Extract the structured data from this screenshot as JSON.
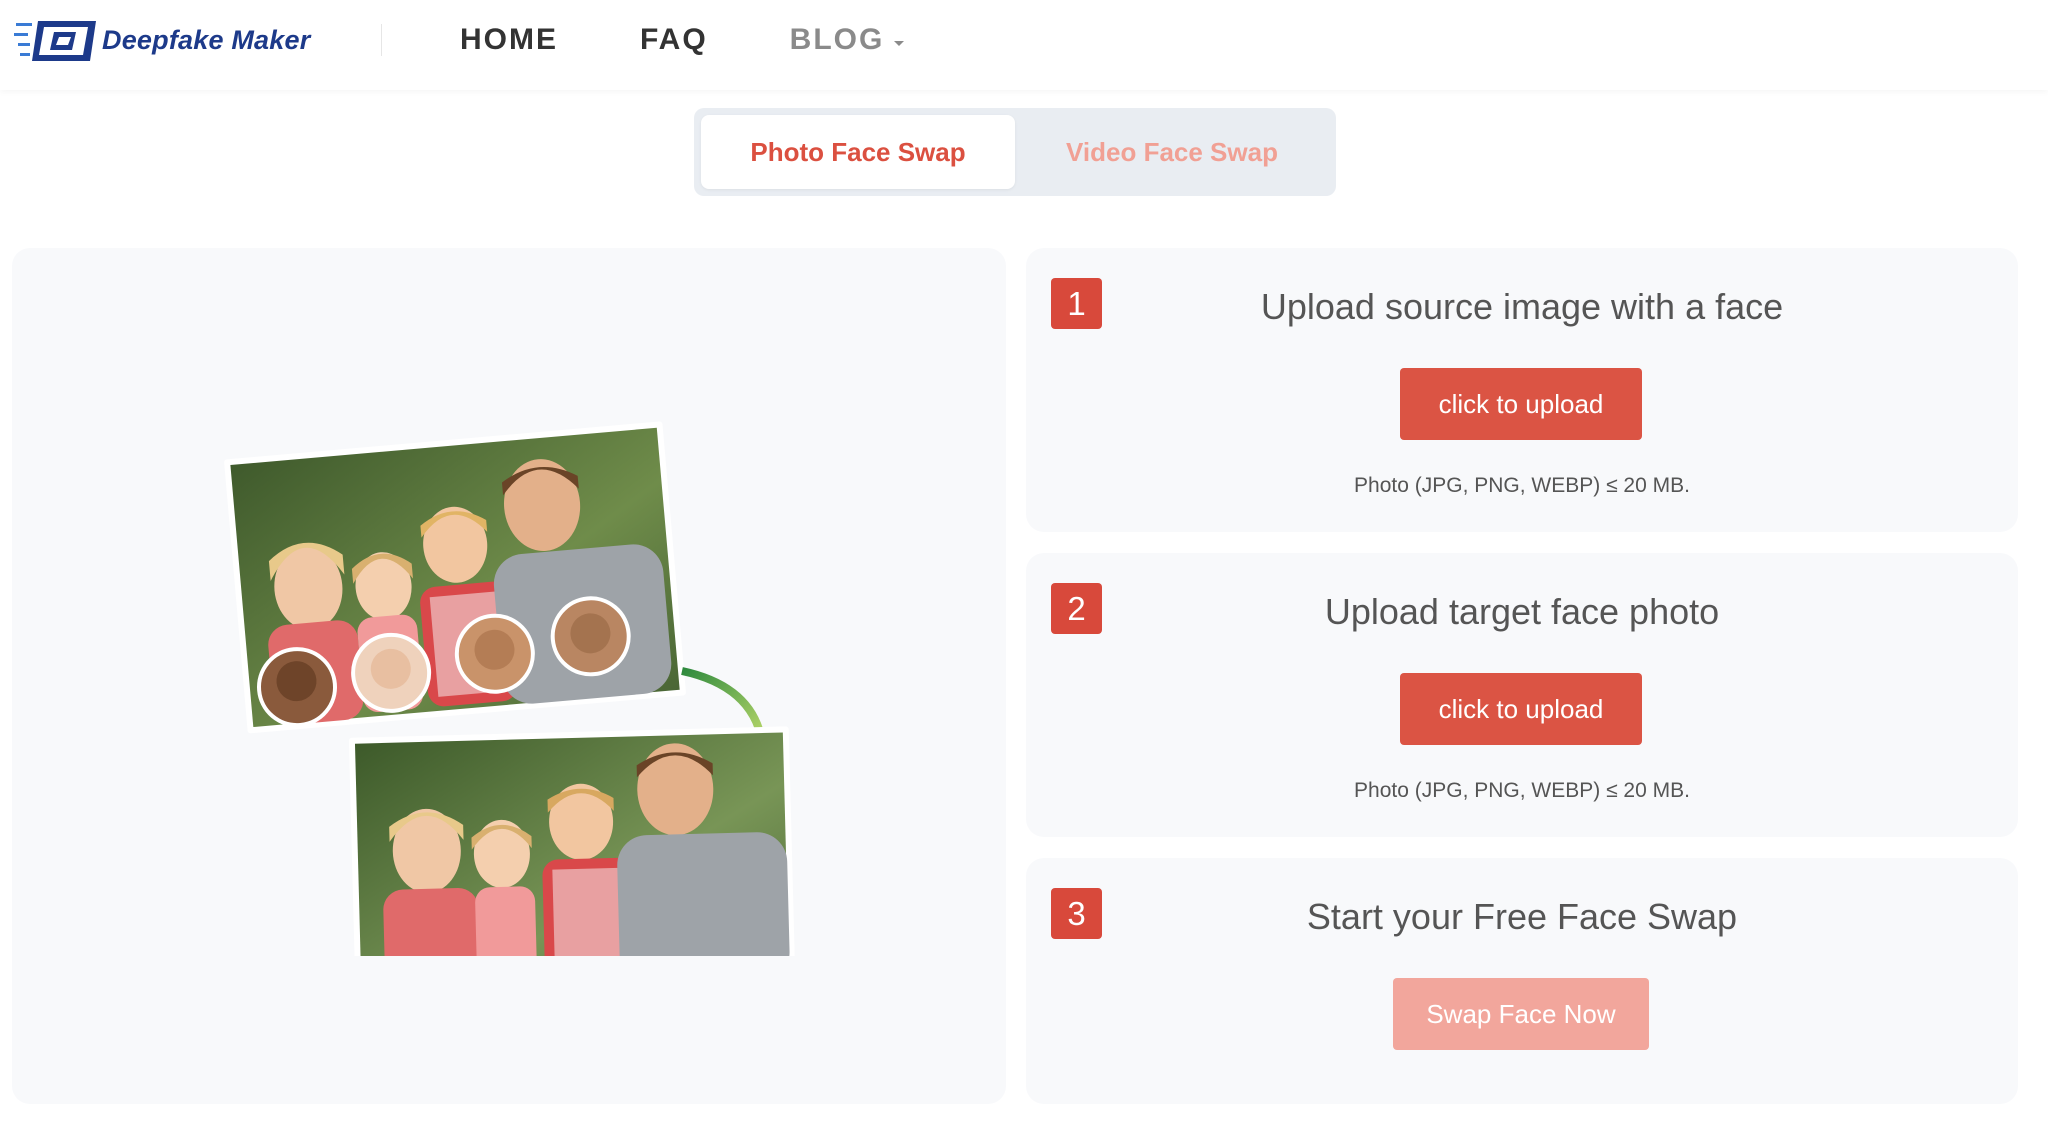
{
  "brand": {
    "name": "Deepfake Maker",
    "colors": {
      "primary": "#1d3a8a",
      "accent": "#db5444",
      "accent_light": "#f2a69c"
    }
  },
  "nav": {
    "items": [
      {
        "label": "HOME"
      },
      {
        "label": "FAQ"
      },
      {
        "label": "BLOG",
        "has_dropdown": true
      }
    ]
  },
  "tabs": [
    {
      "label": "Photo Face Swap",
      "active": true
    },
    {
      "label": "Video Face Swap",
      "active": false
    }
  ],
  "steps": [
    {
      "number": "1",
      "title": "Upload source image with a face",
      "button": "click to upload",
      "note": "Photo (JPG, PNG, WEBP) ≤ 20 MB."
    },
    {
      "number": "2",
      "title": "Upload target face photo",
      "button": "click to upload",
      "note": "Photo (JPG, PNG, WEBP) ≤ 20 MB."
    },
    {
      "number": "3",
      "title": "Start your Free Face Swap",
      "button": "Swap Face Now",
      "button_state": "disabled"
    }
  ],
  "illustration": {
    "icon": "face-swap-illustration"
  }
}
